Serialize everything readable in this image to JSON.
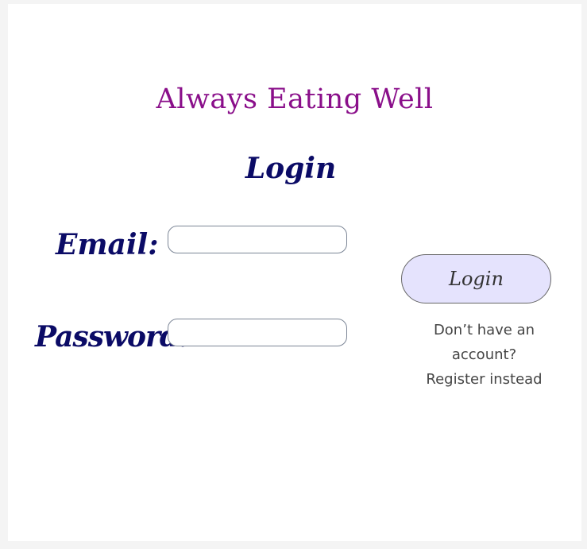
{
  "app": {
    "title": "Always Eating Well"
  },
  "page": {
    "title": "Login"
  },
  "form": {
    "email_label": "Email:",
    "email_value": "",
    "email_placeholder": "",
    "password_label": "Password:",
    "password_value": "",
    "password_placeholder": "",
    "login_button_label": "Login"
  },
  "register": {
    "prompt_line1": "Don’t have an",
    "prompt_line2": "account?",
    "link_label": "Register instead"
  },
  "colors": {
    "app_title": "#8a0f8a",
    "labels": "#0b0b66",
    "button_bg": "#e5e3fd",
    "input_border": "#7c8696",
    "background": "#f4f4f4"
  }
}
